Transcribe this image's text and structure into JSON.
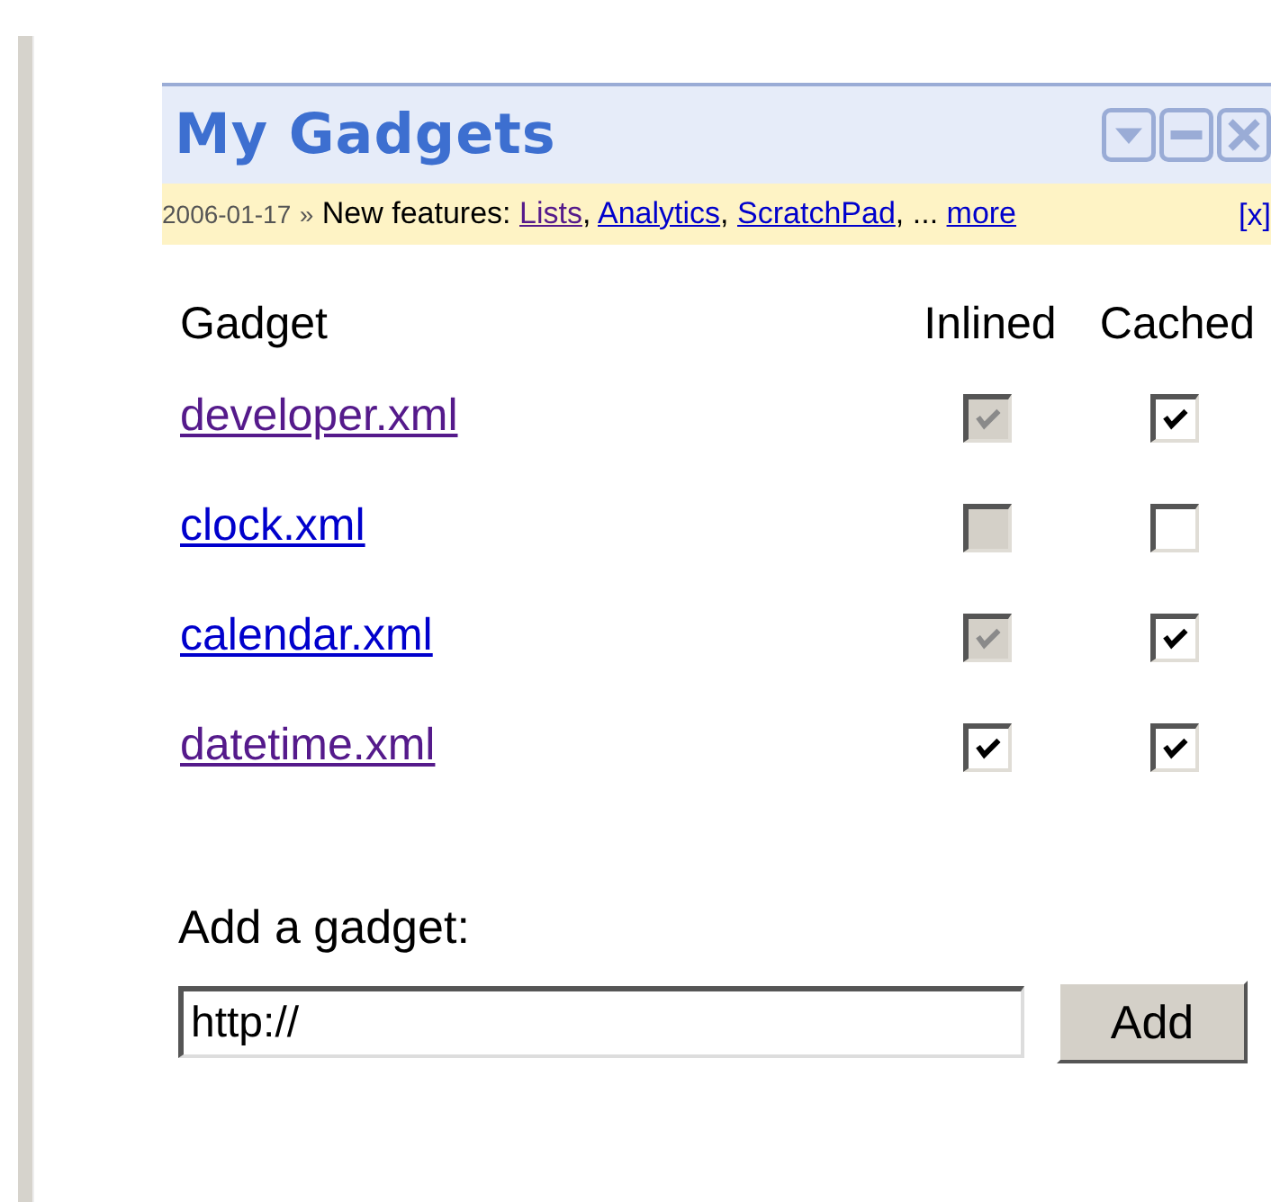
{
  "gadget_panel": {
    "title": "My Gadgets",
    "controls": [
      {
        "kind": "menu"
      },
      {
        "kind": "minimize"
      },
      {
        "kind": "close"
      }
    ]
  },
  "notice": {
    "date": "2006-01-17",
    "separator": "»",
    "lead": "New features:",
    "links": [
      {
        "label": "Lists",
        "visited": true,
        "punct": ","
      },
      {
        "label": "Analytics",
        "visited": false,
        "punct": ","
      },
      {
        "label": "ScratchPad",
        "visited": false,
        "punct": ","
      }
    ],
    "ellipsis": "...",
    "more": "more",
    "dismiss": "[x]"
  },
  "table": {
    "columns": [
      "Gadget",
      "Inlined",
      "Cached"
    ],
    "rows": [
      {
        "name": "developer.xml",
        "visited": true,
        "inlined": {
          "checked": true,
          "disabled": true
        },
        "cached": {
          "checked": true,
          "disabled": false
        }
      },
      {
        "name": "clock.xml",
        "visited": false,
        "inlined": {
          "checked": false,
          "disabled": true
        },
        "cached": {
          "checked": false,
          "disabled": false
        }
      },
      {
        "name": "calendar.xml",
        "visited": false,
        "inlined": {
          "checked": true,
          "disabled": true
        },
        "cached": {
          "checked": true,
          "disabled": false
        }
      },
      {
        "name": "datetime.xml",
        "visited": true,
        "inlined": {
          "checked": true,
          "disabled": false
        },
        "cached": {
          "checked": true,
          "disabled": false
        }
      }
    ]
  },
  "add_gadget": {
    "label": "Add a gadget:",
    "value": "http://",
    "button": "Add"
  }
}
